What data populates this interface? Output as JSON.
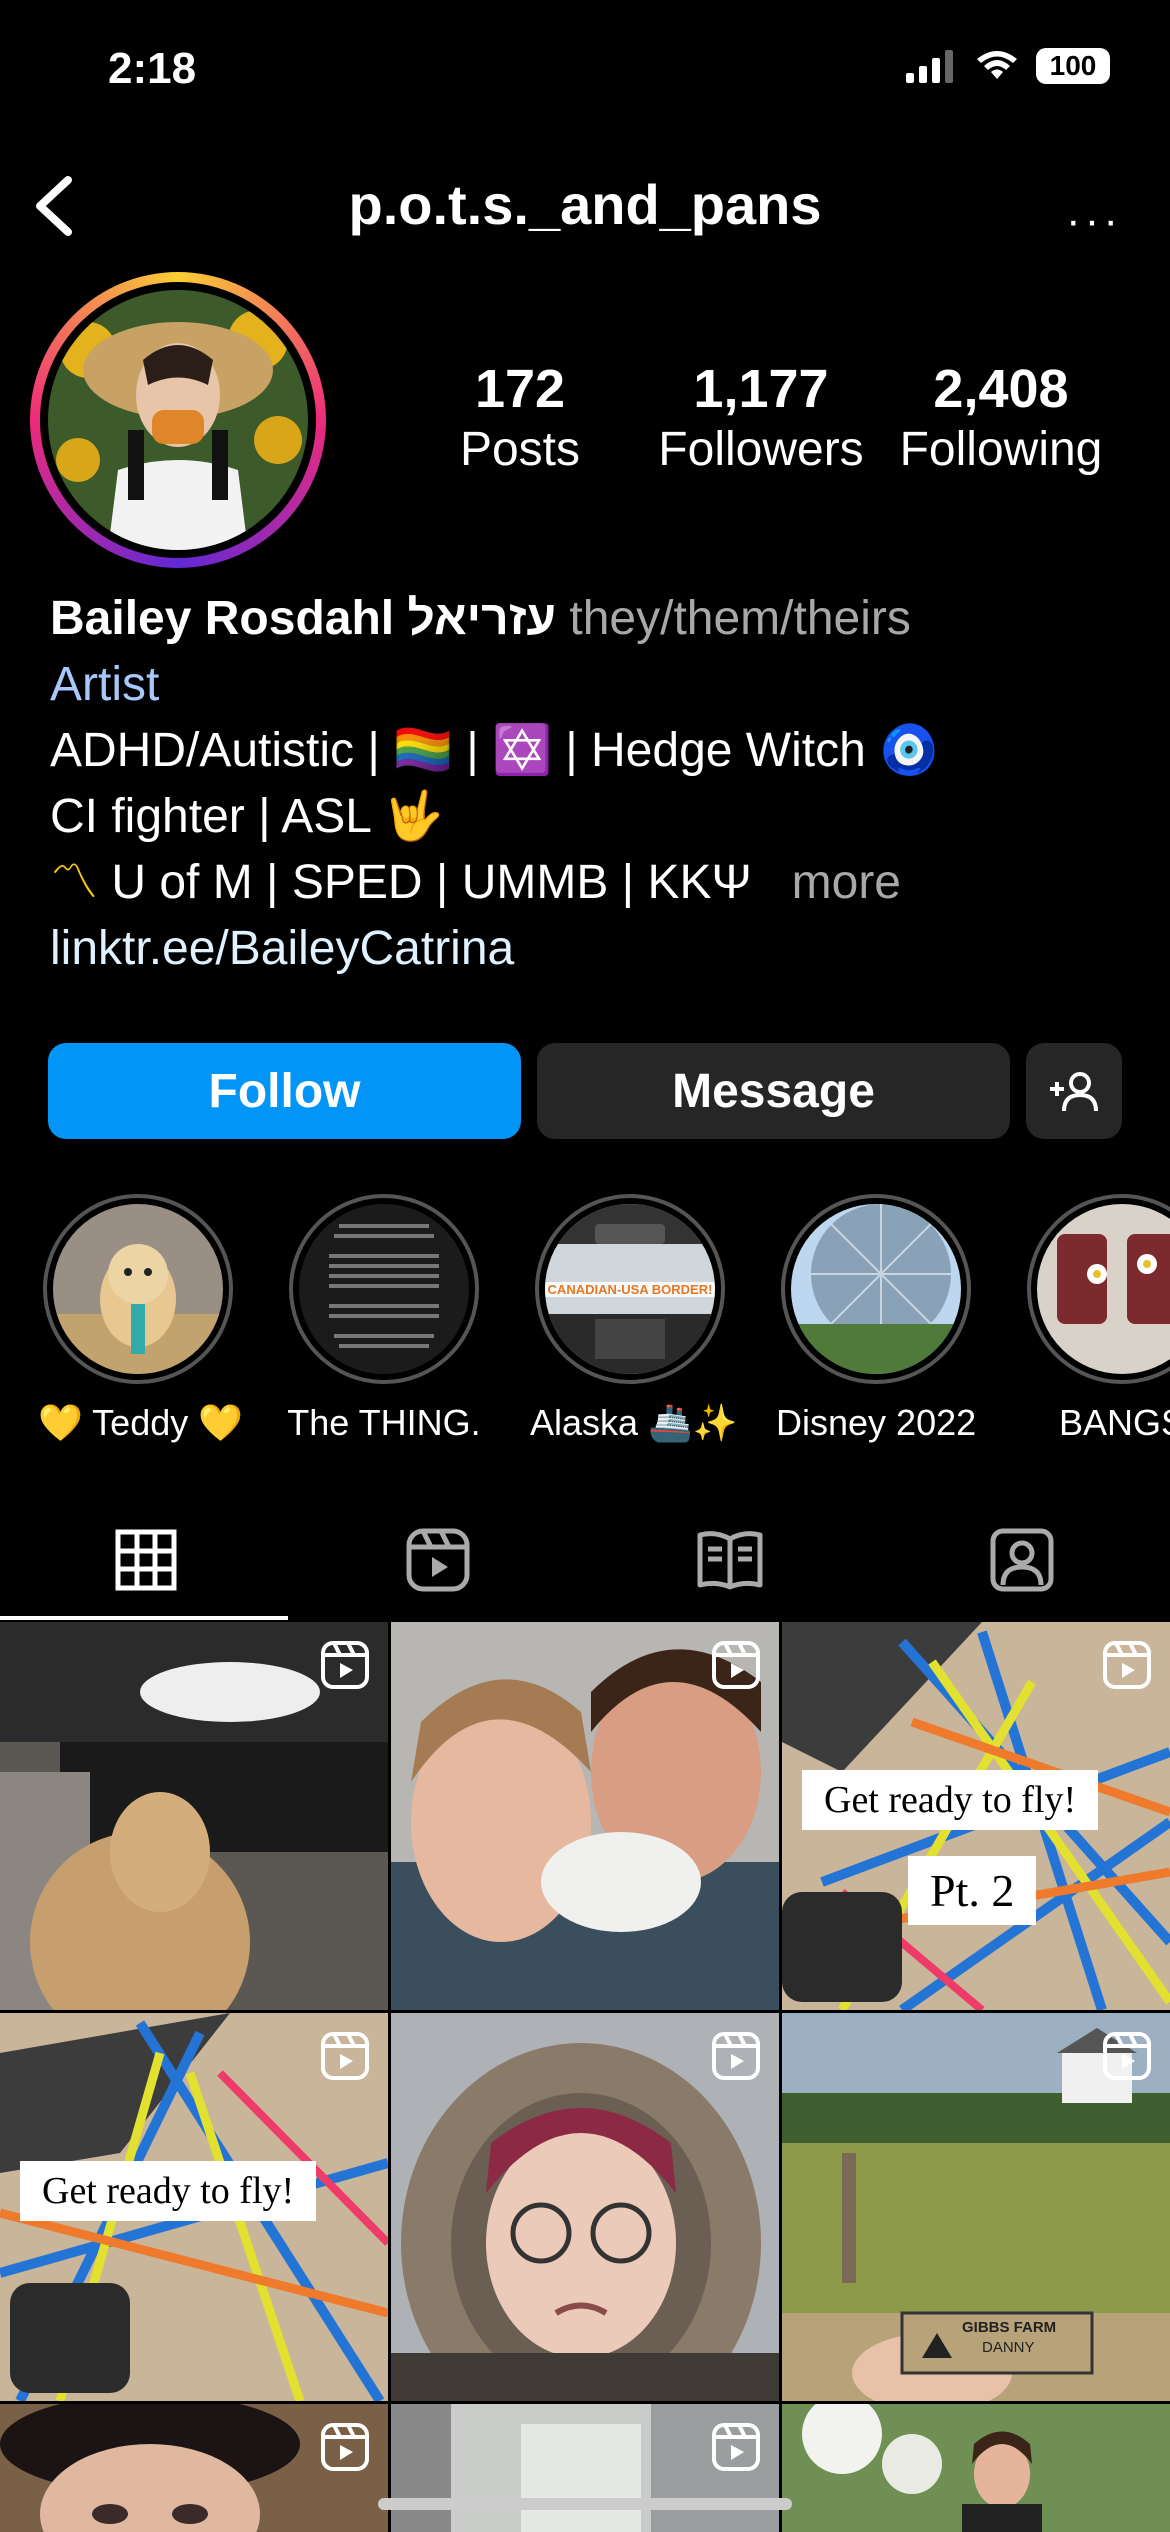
{
  "status": {
    "time": "2:18",
    "battery": "100"
  },
  "header": {
    "username": "p.o.t.s._and_pans",
    "more": "···"
  },
  "stats": [
    {
      "value": "172",
      "label": "Posts"
    },
    {
      "value": "1,177",
      "label": "Followers"
    },
    {
      "value": "2,408",
      "label": "Following"
    }
  ],
  "bio": {
    "name": "Bailey Rosdahl עזריאל",
    "pronouns": "they/them/theirs",
    "category": "Artist",
    "line1_a": "ADHD/Autistic | ",
    "line1_emoji1": "🏳️‍🌈",
    "line1_b": " | ",
    "line1_emoji2": "✡️",
    "line1_c": " | Hedge Witch ",
    "line1_emoji3": "🧿",
    "line2": "CI fighter | ASL ",
    "line2_emoji": "🤟",
    "line3_prefix": "〽",
    "line3": " U of M | SPED | UMMB | KKΨ",
    "more": "more",
    "link": "linktr.ee/BaileyCatrina"
  },
  "buttons": {
    "follow": "Follow",
    "message": "Message",
    "add_icon": "add-person-icon"
  },
  "highlights": [
    {
      "label": "💛 Teddy 💛"
    },
    {
      "label": "The THING."
    },
    {
      "label": "Alaska 🚢✨"
    },
    {
      "label": "Disney 2022"
    },
    {
      "label": "BANGS"
    }
  ],
  "highlight_texts": {
    "alaska_banner": "CANADIAN-USA BORDER!"
  },
  "tabs": [
    {
      "icon": "grid-icon",
      "active": true
    },
    {
      "icon": "reels-icon",
      "active": false
    },
    {
      "icon": "guides-icon",
      "active": false
    },
    {
      "icon": "tagged-icon",
      "active": false
    }
  ],
  "grid": {
    "caption_fly": "Get ready to fly!",
    "caption_pt2": "Pt. 2",
    "caption_fly2": "Get ready to fly!",
    "sign_title": "GIBBS FARM",
    "sign_name": "DANNY"
  }
}
